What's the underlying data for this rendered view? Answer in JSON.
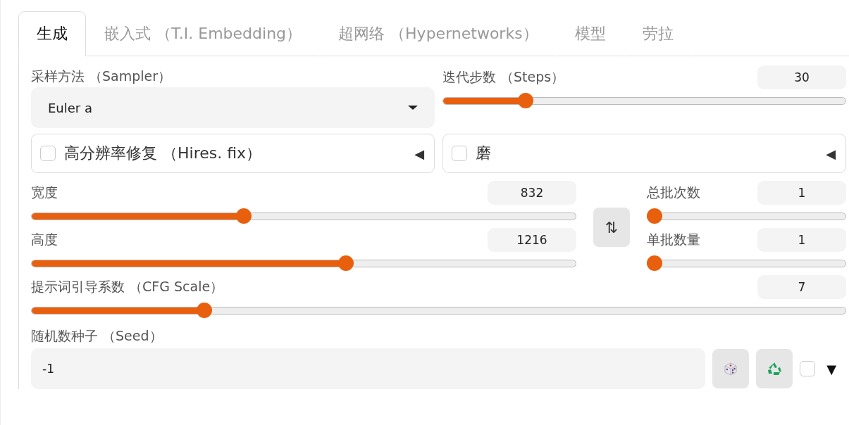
{
  "tabs": [
    {
      "label": "生成",
      "selected": true
    },
    {
      "label": "嵌入式 （T.I. Embedding）",
      "selected": false
    },
    {
      "label": "超网络 （Hypernetworks）",
      "selected": false
    },
    {
      "label": "模型",
      "selected": false
    },
    {
      "label": "劳拉",
      "selected": false
    }
  ],
  "sampler": {
    "label": "采样方法 （Sampler）",
    "value": "Euler a"
  },
  "steps": {
    "label": "迭代步数 （Steps）",
    "value": "30",
    "level": 0.206
  },
  "accordions": [
    {
      "label": "高分辨率修复 （Hires. fix）",
      "checked": false,
      "toggle": "◀"
    },
    {
      "label": "磨",
      "checked": false,
      "toggle": "◀"
    }
  ],
  "width": {
    "label": "宽度",
    "value": "832",
    "level": 0.39
  },
  "height": {
    "label": "高度",
    "value": "1216",
    "level": 0.578
  },
  "swap_button": "⇅",
  "batch_count": {
    "label": "总批次数",
    "value": "1",
    "level": 0
  },
  "batch_size": {
    "label": "单批数量",
    "value": "1",
    "level": 0
  },
  "cfg_scale": {
    "label": "提示词引导系数 （CFG Scale）",
    "value": "7",
    "level": 0.213
  },
  "seed": {
    "label": "随机数种子 （Seed）",
    "value": "-1",
    "checked": false,
    "toggle": "▼"
  }
}
